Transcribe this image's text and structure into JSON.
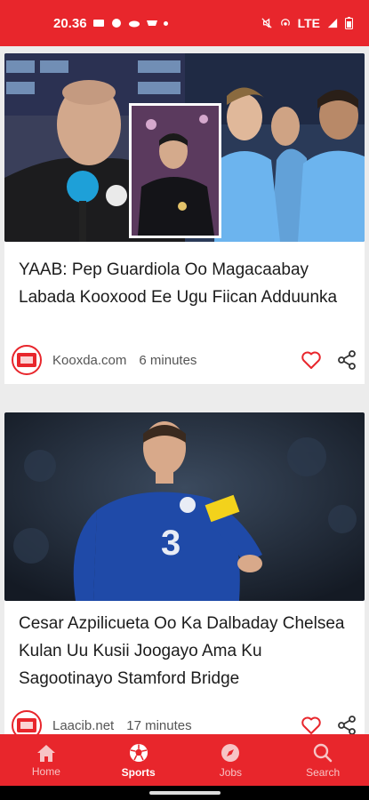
{
  "status_bar": {
    "time": "20.36",
    "network": "LTE"
  },
  "articles": [
    {
      "title": "YAAB: Pep Guardiola Oo Magacaabay Labada Kooxood Ee Ugu Fiican Adduunka",
      "source": "Kooxda.com",
      "time_ago": "6 minutes",
      "image": "guardiola-press-conference-and-man-city-players-icon"
    },
    {
      "title": "Cesar Azpilicueta Oo Ka Dalbaday Chelsea Kulan Uu Kusii Joogayo Ama Ku Sagootinayo Stamford Bridge",
      "source": "Laacib.net",
      "time_ago": "17 minutes",
      "image": "azpilicueta-chelsea-player-icon"
    }
  ],
  "bottom_nav": {
    "items": [
      {
        "label": "Home",
        "icon": "home-icon"
      },
      {
        "label": "Sports",
        "icon": "football-icon"
      },
      {
        "label": "Jobs",
        "icon": "compass-icon"
      },
      {
        "label": "Search",
        "icon": "search-icon"
      }
    ],
    "active": "Sports"
  },
  "colors": {
    "brand_red": "#e8262c",
    "card_bg": "#ffffff",
    "feed_bg": "#ececec"
  }
}
